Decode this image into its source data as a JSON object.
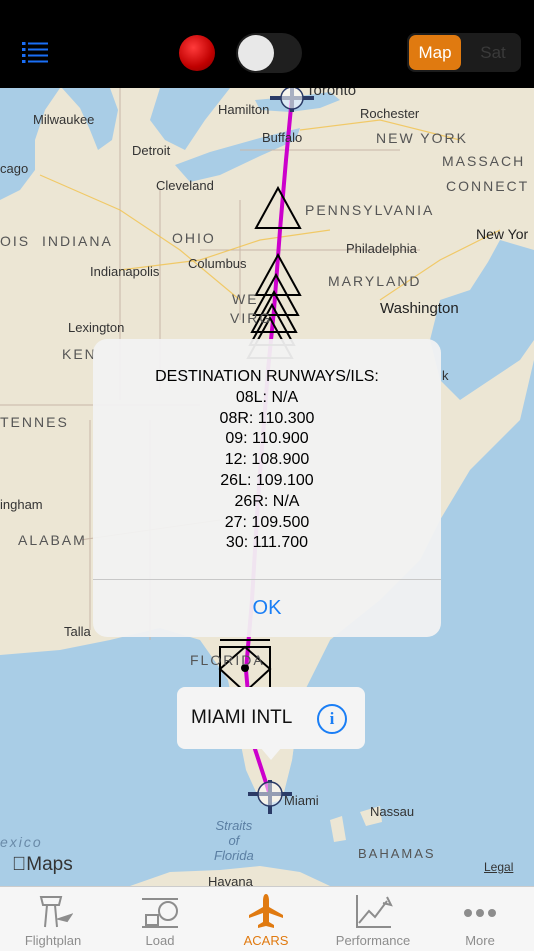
{
  "topbar": {
    "map_label": "Map",
    "sat_label": "Sat"
  },
  "map": {
    "places": {
      "toronto": "Toronto",
      "hamilton": "Hamilton",
      "rochester": "Rochester",
      "milwaukee": "Milwaukee",
      "buffalo": "Buffalo",
      "new_york_state": "NEW YORK",
      "detroit": "Detroit",
      "massachusetts": "MASSACH",
      "chicago": "cago",
      "cleveland": "Cleveland",
      "connecticut": "CONNECT",
      "pennsylvania": "PENNSYLVANIA",
      "illinois": "OIS",
      "indiana": "INDIANA",
      "ohio": "OHIO",
      "new_york_city": "New Yor",
      "columbus": "Columbus",
      "philadelphia": "Philadelphia",
      "indianapolis": "Indianapolis",
      "maryland": "MARYLAND",
      "washington": "Washington",
      "west_virginia": "WE",
      "virginia": "VIRG",
      "lexington": "Lexington",
      "kentucky": "KEN",
      "tennessee": "TENNES",
      "norfolk": "k",
      "birmingham": "ingham",
      "alabama": "ALABAM",
      "tallahassee": "Talla",
      "florida": "FLORIDA",
      "miami": "Miami",
      "nassau": "Nassau",
      "mexico": "exico",
      "straits": "Straits\nof\nFlorida",
      "bahamas": "BAHAMAS",
      "havana": "Havana"
    },
    "attribution": "Maps",
    "legal": "Legal"
  },
  "alert": {
    "title": "DESTINATION RUNWAYS/ILS:",
    "runways": [
      "08L: N/A",
      "08R: 110.300",
      "09: 110.900",
      "12: 108.900",
      "26L: 109.100",
      "26R: N/A",
      "27: 109.500",
      "30: 111.700"
    ],
    "ok_label": "OK"
  },
  "callout": {
    "name": "MIAMI INTL",
    "info_glyph": "i"
  },
  "tabs": [
    {
      "label": "Flightplan",
      "icon": "control-tower-icon"
    },
    {
      "label": "Load",
      "icon": "cargo-loader-icon"
    },
    {
      "label": "ACARS",
      "icon": "airplane-icon"
    },
    {
      "label": "Performance",
      "icon": "performance-chart-icon"
    },
    {
      "label": "More",
      "icon": "more-dots-icon"
    }
  ],
  "colors": {
    "accent": "#e07a10",
    "route": "#cc00cc",
    "link": "#1a7ef5"
  }
}
